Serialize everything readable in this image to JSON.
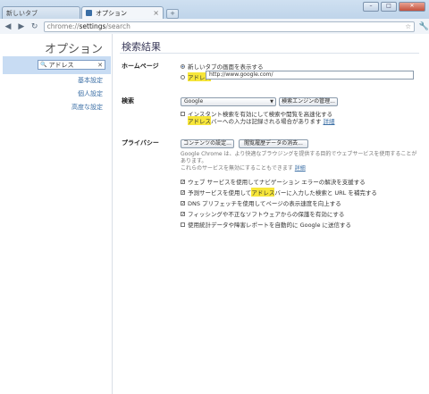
{
  "browser": {
    "tabs": [
      {
        "label": "新しいタブ"
      },
      {
        "label": "オプション"
      }
    ],
    "newtab_label": "+",
    "url_scheme": "chrome://",
    "url_host": "settings",
    "url_path": "/search"
  },
  "sidebar": {
    "title": "オプション",
    "search_value": "アドレス",
    "links": [
      "基本設定",
      "個人設定",
      "高度な設定"
    ]
  },
  "main": {
    "title": "検索結果",
    "homepage": {
      "label": "ホームページ",
      "option_newtab": "新しいタブの画面を表示する",
      "option_address": "アドレス",
      "address_value": "http://www.google.com/"
    },
    "search": {
      "label": "検索",
      "engine": "Google",
      "manage_button": "検索エンジンの管理...",
      "instant_line1": "インスタント検索を有効にして検索や閲覧を高速化する",
      "instant_line2_hl": "アドレス",
      "instant_line2_rest": "バーへの入力は記録される場合があります",
      "instant_link": "詳細"
    },
    "privacy": {
      "label": "プライバシー",
      "content_settings_button": "コンテンツの設定...",
      "clear_data_button": "閲覧履歴データの消去...",
      "note_line1": "Google Chrome は、より快適なブラウジングを提供する目的でウェブサービスを使用することがあります。",
      "note_line2": "これらのサービスを無効にすることもできます",
      "note_link": "詳細",
      "items": [
        {
          "pre": "ウェブ サービスを使用してナビゲーション エラーの解決を支援する",
          "hl": "",
          "post": "",
          "checked": true
        },
        {
          "pre": "予測サービスを使用して",
          "hl": "アドレス",
          "post": "バーに入力した検索と URL を補完する",
          "checked": true
        },
        {
          "pre": "DNS プリフェッチを使用してページの表示速度を向上する",
          "hl": "",
          "post": "",
          "checked": true
        },
        {
          "pre": "フィッシングや不正なソフトウェアからの保護を有効にする",
          "hl": "",
          "post": "",
          "checked": true
        },
        {
          "pre": "使用統計データや障害レポートを自動的に Google に送信する",
          "hl": "",
          "post": "",
          "checked": false
        }
      ]
    }
  }
}
